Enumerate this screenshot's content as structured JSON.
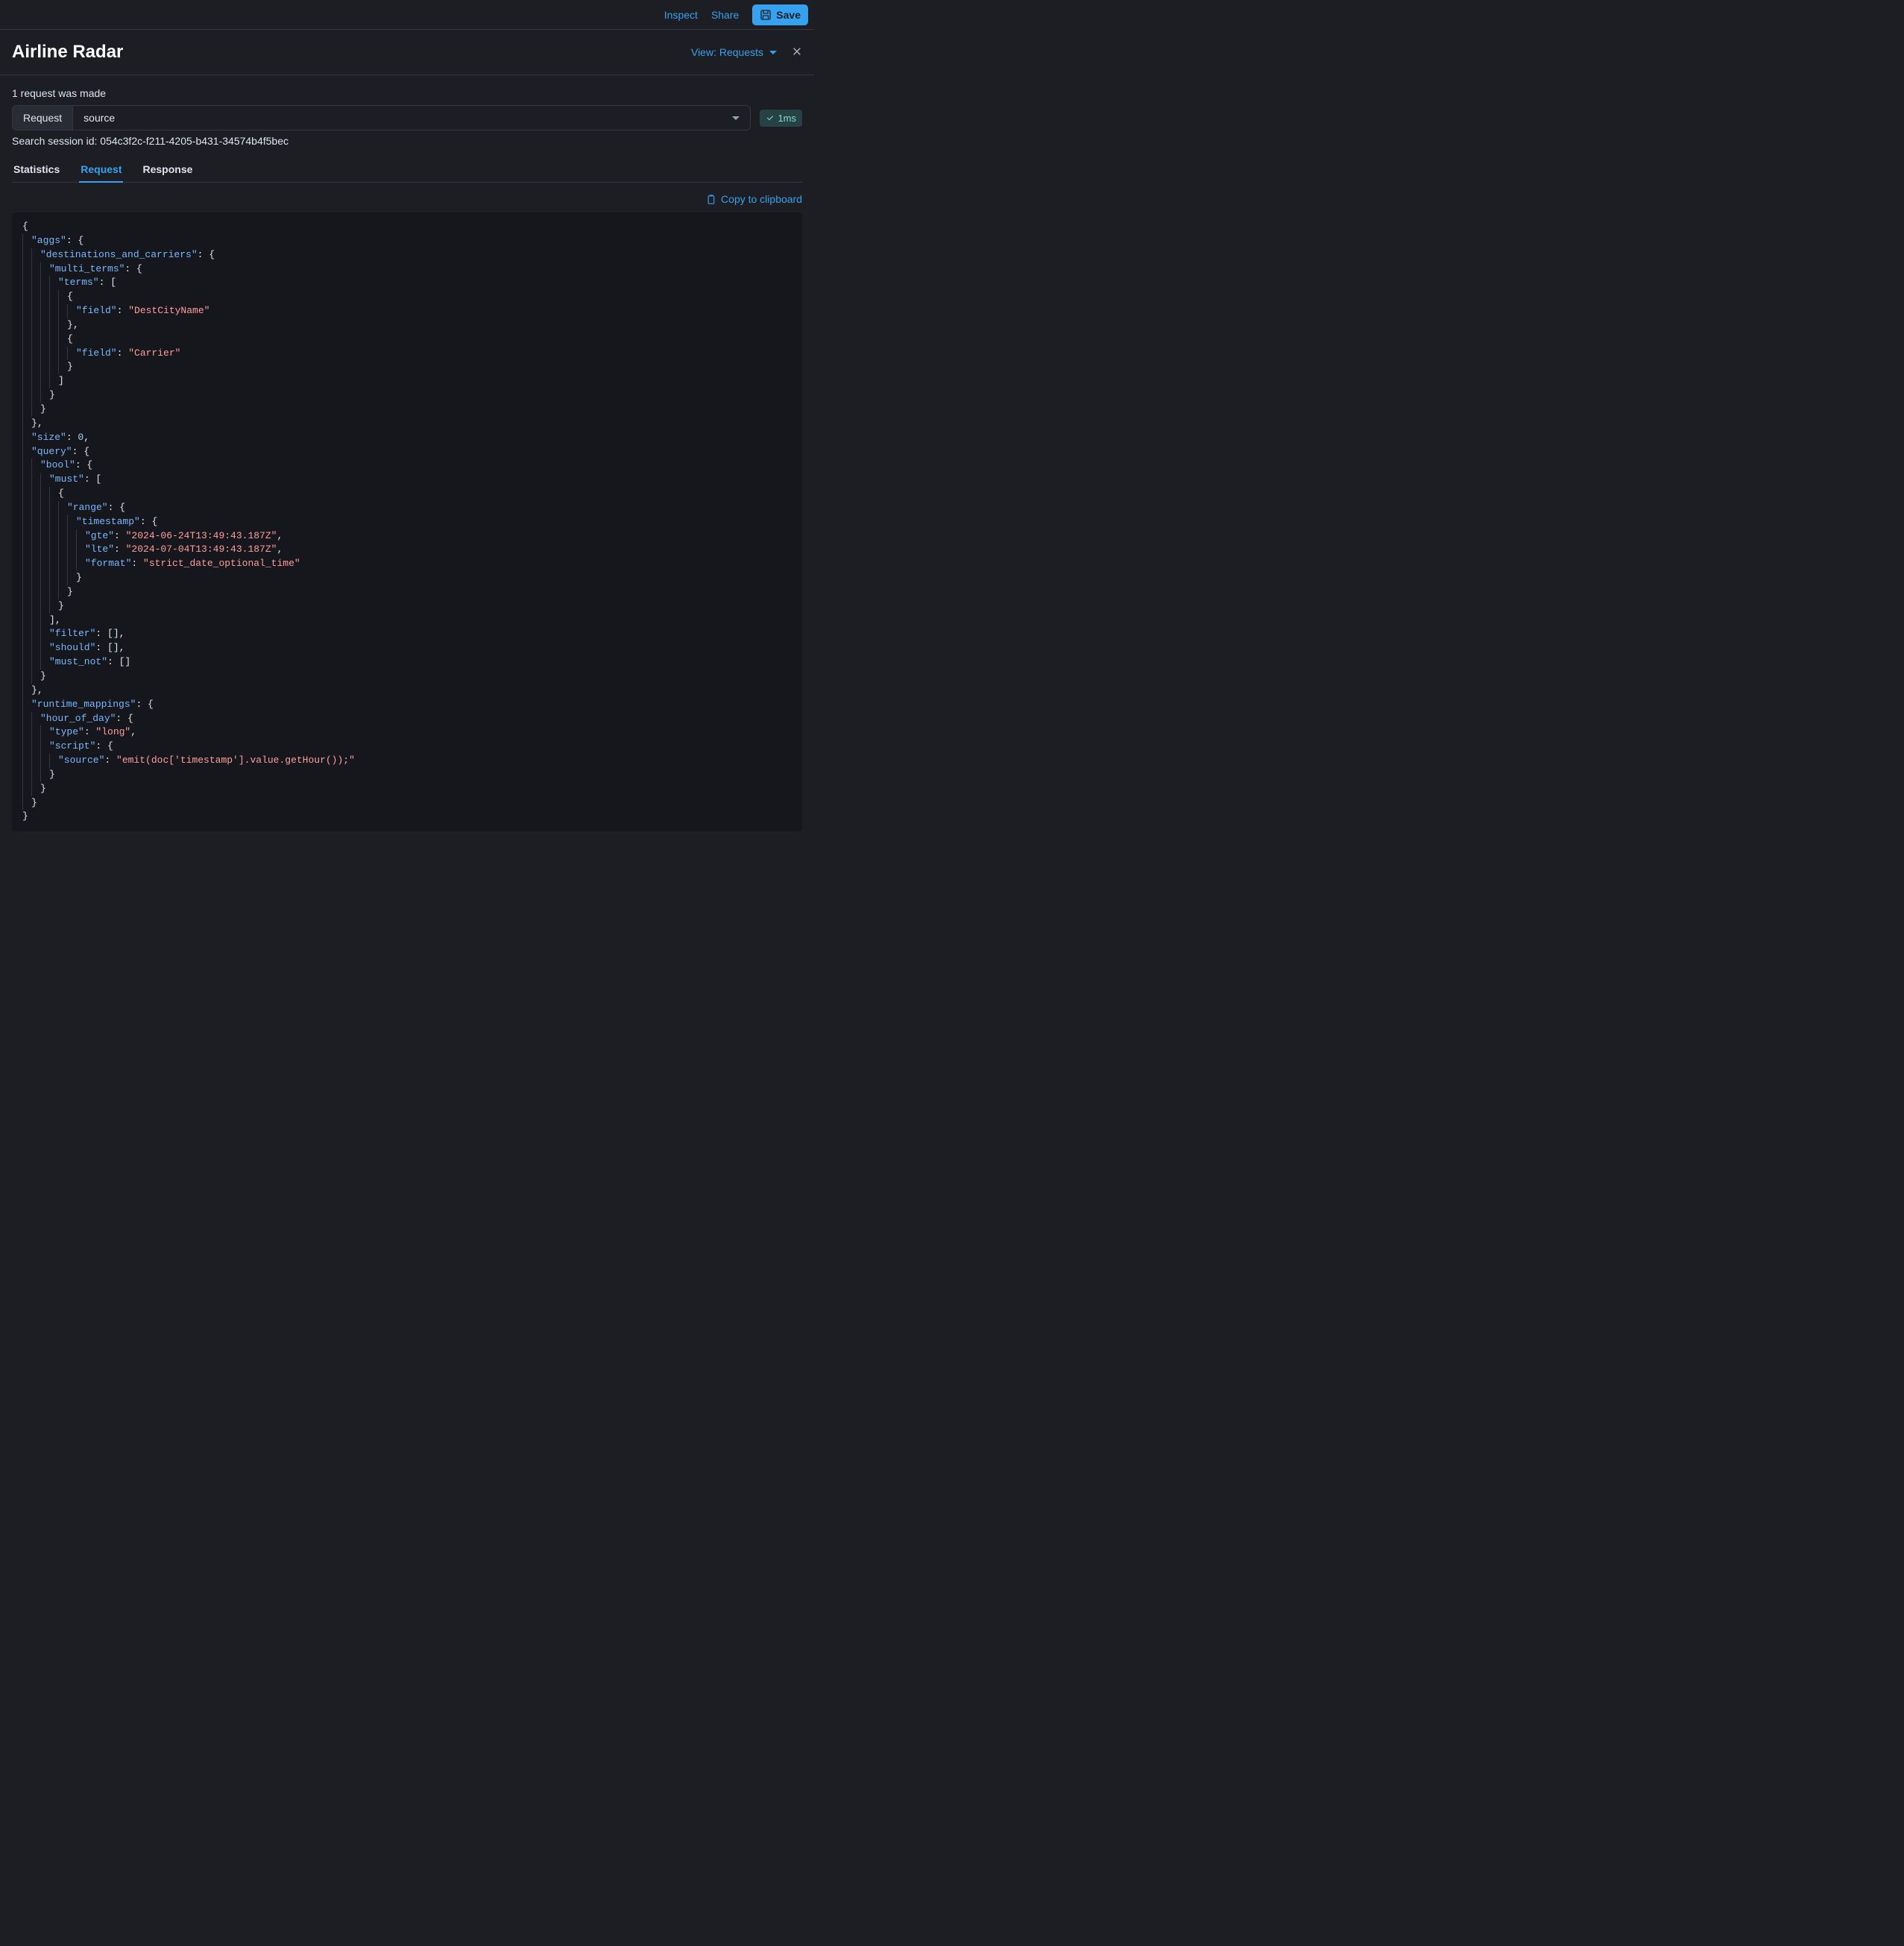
{
  "topbar": {
    "inspect": "Inspect",
    "share": "Share",
    "save": "Save"
  },
  "header": {
    "title": "Airline Radar",
    "view_label": "View: Requests"
  },
  "requests": {
    "count_text": "1 request was made",
    "segment_label": "Request",
    "selected": "source",
    "time_badge": "1ms"
  },
  "session": {
    "label": "Search session id: 054c3f2c-f211-4205-b431-34574b4f5bec"
  },
  "tabs": {
    "statistics": "Statistics",
    "request": "Request",
    "response": "Response"
  },
  "actions": {
    "copy": "Copy to clipboard"
  },
  "request_body": {
    "aggs": {
      "destinations_and_carriers": {
        "multi_terms": {
          "terms": [
            {
              "field": "DestCityName"
            },
            {
              "field": "Carrier"
            }
          ]
        }
      }
    },
    "size": 0,
    "query": {
      "bool": {
        "must": [
          {
            "range": {
              "timestamp": {
                "gte": "2024-06-24T13:49:43.187Z",
                "lte": "2024-07-04T13:49:43.187Z",
                "format": "strict_date_optional_time"
              }
            }
          }
        ],
        "filter": [],
        "should": [],
        "must_not": []
      }
    },
    "runtime_mappings": {
      "hour_of_day": {
        "type": "long",
        "script": {
          "source": "emit(doc['timestamp'].value.getHour());"
        }
      }
    }
  }
}
